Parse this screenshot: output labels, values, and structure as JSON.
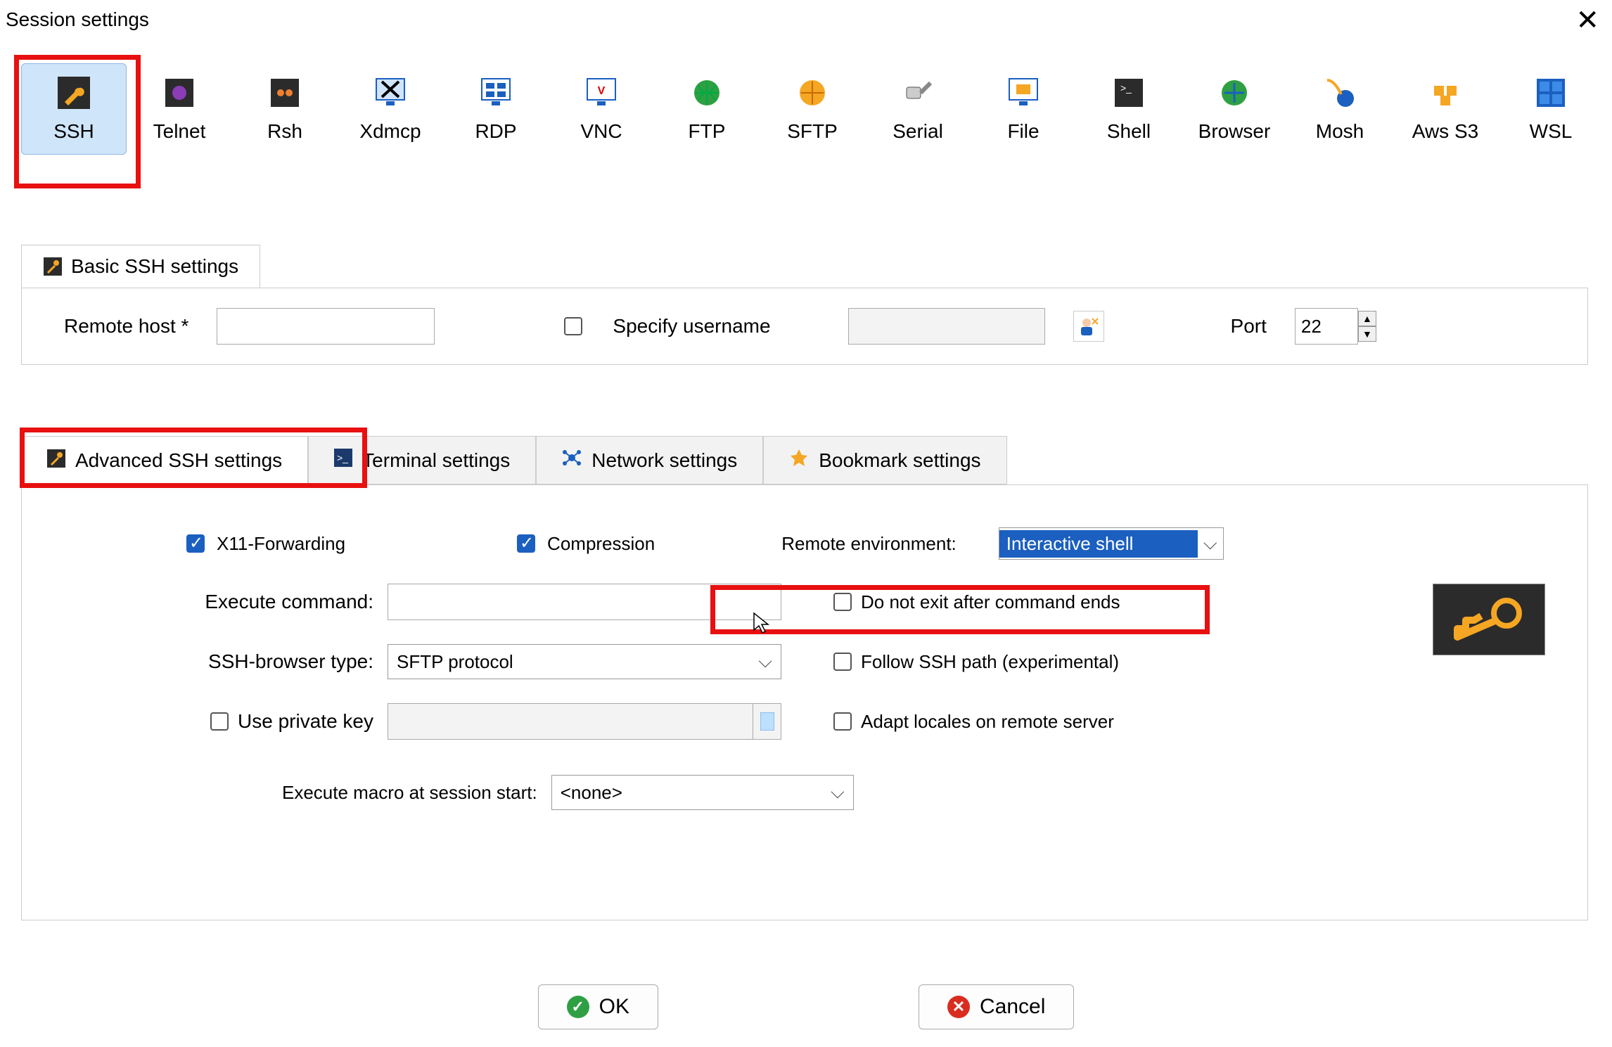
{
  "window": {
    "title": "Session settings"
  },
  "protocols": [
    {
      "id": "ssh",
      "label": "SSH",
      "selected": true
    },
    {
      "id": "telnet",
      "label": "Telnet"
    },
    {
      "id": "rsh",
      "label": "Rsh"
    },
    {
      "id": "xdmcp",
      "label": "Xdmcp"
    },
    {
      "id": "rdp",
      "label": "RDP"
    },
    {
      "id": "vnc",
      "label": "VNC"
    },
    {
      "id": "ftp",
      "label": "FTP"
    },
    {
      "id": "sftp",
      "label": "SFTP"
    },
    {
      "id": "serial",
      "label": "Serial"
    },
    {
      "id": "file",
      "label": "File"
    },
    {
      "id": "shell",
      "label": "Shell"
    },
    {
      "id": "browser",
      "label": "Browser"
    },
    {
      "id": "mosh",
      "label": "Mosh"
    },
    {
      "id": "awss3",
      "label": "Aws S3"
    },
    {
      "id": "wsl",
      "label": "WSL"
    }
  ],
  "basic": {
    "tab_label": "Basic SSH settings",
    "remote_host_label": "Remote host *",
    "remote_host_value": "",
    "specify_username_label": "Specify username",
    "specify_username_checked": false,
    "username_value": "",
    "port_label": "Port",
    "port_value": "22"
  },
  "adv_tabs": {
    "advanced": "Advanced SSH settings",
    "terminal": "Terminal settings",
    "network": "Network settings",
    "bookmark": "Bookmark settings"
  },
  "advanced": {
    "x11_label": "X11-Forwarding",
    "x11_checked": true,
    "compression_label": "Compression",
    "compression_checked": true,
    "remote_env_label": "Remote environment:",
    "remote_env_value": "Interactive shell",
    "exec_cmd_label": "Execute command:",
    "exec_cmd_value": "",
    "do_not_exit_label": "Do not exit after command ends",
    "do_not_exit_checked": false,
    "ssh_browser_label": "SSH-browser type:",
    "ssh_browser_value": "SFTP protocol",
    "follow_ssh_label": "Follow SSH path (experimental)",
    "follow_ssh_checked": false,
    "use_pk_label": "Use private key",
    "use_pk_checked": false,
    "pk_path_value": "",
    "adapt_locales_label": "Adapt locales on remote server",
    "adapt_locales_checked": false,
    "macro_label": "Execute macro at session start:",
    "macro_value": "<none>"
  },
  "footer": {
    "ok": "OK",
    "cancel": "Cancel"
  }
}
